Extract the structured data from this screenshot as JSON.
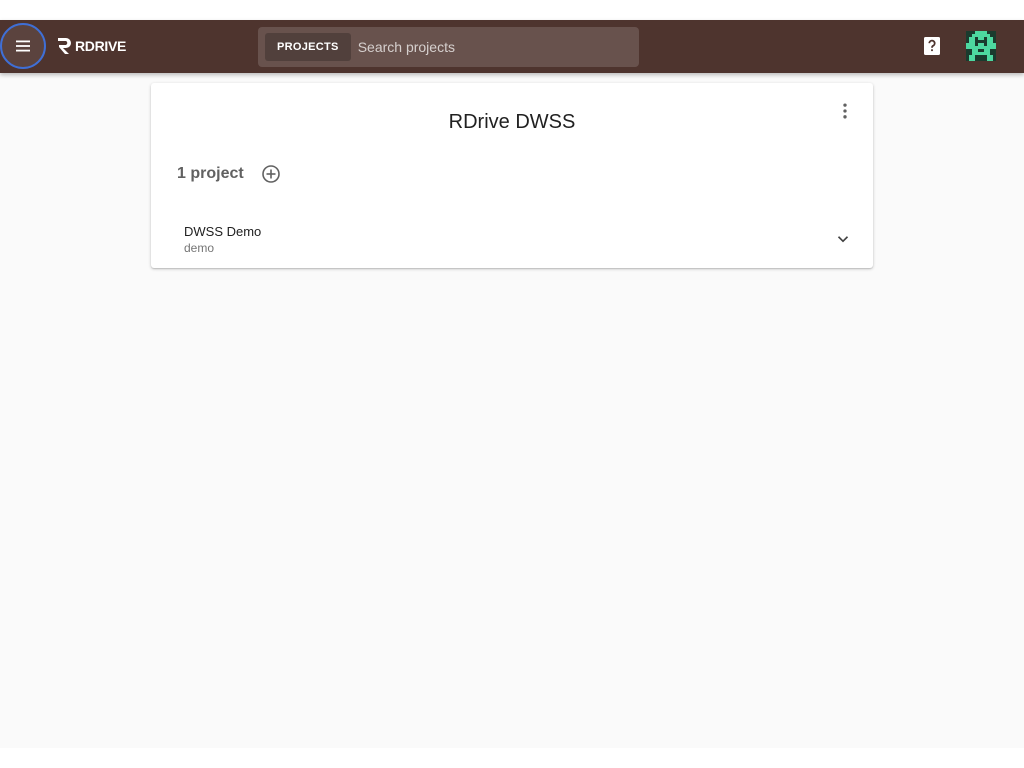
{
  "header": {
    "menu_icon": "menu-icon",
    "logo_text": "RDRIVE",
    "search": {
      "scope_label": "PROJECTS",
      "placeholder": "Search projects",
      "value": ""
    },
    "help_icon": "help-icon",
    "avatar_icon": "identicon-avatar"
  },
  "card": {
    "title": "RDrive DWSS",
    "more_icon": "more-vert-icon",
    "project_count_label": "1 project",
    "add_icon": "add-circle-icon",
    "projects": [
      {
        "name": "DWSS Demo",
        "slug": "demo",
        "expand_icon": "chevron-down-icon"
      }
    ]
  },
  "colors": {
    "appbar": "#4e342e",
    "focus_ring": "#3f6fd6",
    "avatar_green": "#4dd8a0",
    "avatar_dark": "#1a3b2e",
    "background": "#fafafa"
  }
}
